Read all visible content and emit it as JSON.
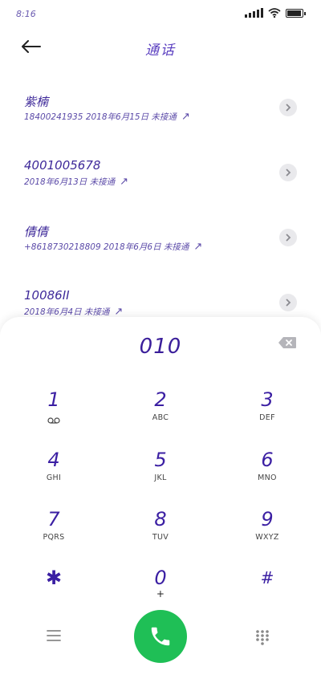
{
  "status": {
    "time": "8:16"
  },
  "header": {
    "title": "通话"
  },
  "calls": [
    {
      "name": "紫楠",
      "meta": "18400241935 2018年6月15日 未接通"
    },
    {
      "name": "4001005678",
      "meta": "2018年6月13日 未接通"
    },
    {
      "name": "倩倩",
      "meta": "+8618730218809 2018年6月6日 未接通"
    },
    {
      "name": "10086II",
      "meta": "2018年6月4日 未接通"
    }
  ],
  "dialer": {
    "number": "010",
    "keys": [
      {
        "digit": "1",
        "letters": ""
      },
      {
        "digit": "2",
        "letters": "ABC"
      },
      {
        "digit": "3",
        "letters": "DEF"
      },
      {
        "digit": "4",
        "letters": "GHI"
      },
      {
        "digit": "5",
        "letters": "JKL"
      },
      {
        "digit": "6",
        "letters": "MNO"
      },
      {
        "digit": "7",
        "letters": "PQRS"
      },
      {
        "digit": "8",
        "letters": "TUV"
      },
      {
        "digit": "9",
        "letters": "WXYZ"
      },
      {
        "digit": "✱",
        "letters": ""
      },
      {
        "digit": "0",
        "letters": "+"
      },
      {
        "digit": "#",
        "letters": ""
      }
    ]
  },
  "colors": {
    "call_button": "#1fbf56",
    "accent": "#3b1fa3"
  },
  "icons": {
    "back": "back-arrow-icon",
    "voicemail": "voicemail-icon",
    "backspace": "backspace-icon",
    "menu": "menu-icon",
    "phone": "phone-icon",
    "dialpad": "dialpad-icon"
  }
}
